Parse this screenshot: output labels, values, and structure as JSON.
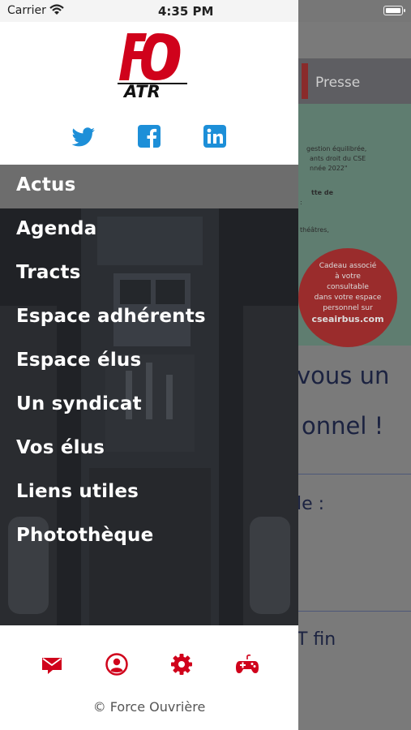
{
  "status_bar": {
    "carrier": "Carrier",
    "time": "4:35 PM"
  },
  "logo": {
    "main": "FO",
    "sub": "ATR"
  },
  "social": [
    {
      "name": "twitter",
      "icon": "twitter-icon"
    },
    {
      "name": "facebook",
      "icon": "facebook-icon"
    },
    {
      "name": "linkedin",
      "icon": "linkedin-icon"
    }
  ],
  "menu": {
    "items": [
      {
        "label": "Actus",
        "active": true
      },
      {
        "label": "Agenda"
      },
      {
        "label": "Tracts"
      },
      {
        "label": "Espace adhérents"
      },
      {
        "label": "Espace élus"
      },
      {
        "label": "Un syndicat"
      },
      {
        "label": "Vos élus"
      },
      {
        "label": "Liens utiles"
      },
      {
        "label": "Photothèque"
      }
    ]
  },
  "footer": {
    "icons": [
      "mail-icon",
      "user-icon",
      "gear-icon",
      "gamepad-icon"
    ],
    "copyright": "© Force Ouvrière"
  },
  "background_page": {
    "tab_label": "Presse",
    "banner_lines": [
      "gestion équilibrée,",
      "ants droit du CSE",
      "nnée 2022\"",
      "tte de",
      ":",
      "théâtres,"
    ],
    "promo_lines": [
      "Cadeau associé",
      "à votre",
      "consultable",
      "dans votre espace",
      "personnel sur"
    ],
    "promo_site": "cseairbus.com",
    "heading_line_1": "vous un",
    "heading_line_2": "onnel !",
    "text_line_1": "le :",
    "text_line_2": "T fin"
  },
  "colors": {
    "brand_red": "#d0021b",
    "active_bg": "#6d6d6d",
    "social_blue": "#1d8fd8",
    "linkedin_blue": "#0a77b5"
  }
}
